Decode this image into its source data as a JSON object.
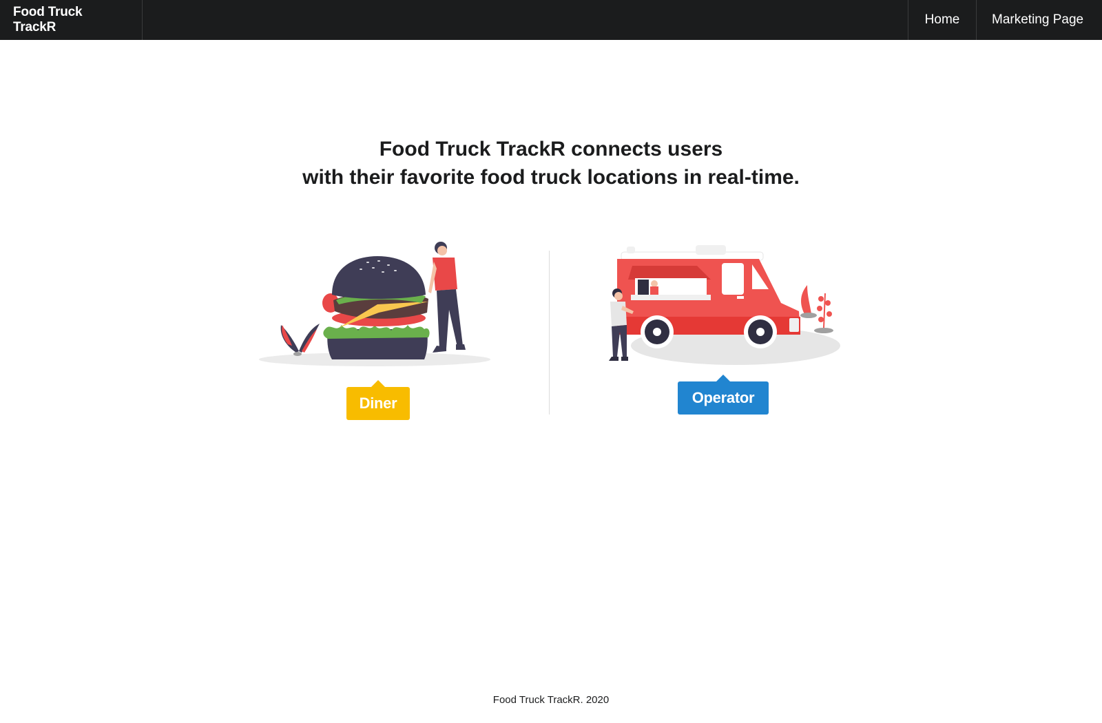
{
  "navbar": {
    "brand": "Food Truck TrackR",
    "items": [
      {
        "label": "Home"
      },
      {
        "label": "Marketing Page"
      }
    ]
  },
  "hero": {
    "line1": "Food Truck TrackR connects users",
    "line2": "with their favorite food truck locations in real-time."
  },
  "roles": {
    "diner": {
      "label": "Diner",
      "color": "#f8bc00",
      "illustration": "burger-person-illustration"
    },
    "operator": {
      "label": "Operator",
      "color": "#2185d0",
      "illustration": "food-truck-illustration"
    }
  },
  "footer": {
    "text": "Food Truck TrackR. 2020"
  }
}
